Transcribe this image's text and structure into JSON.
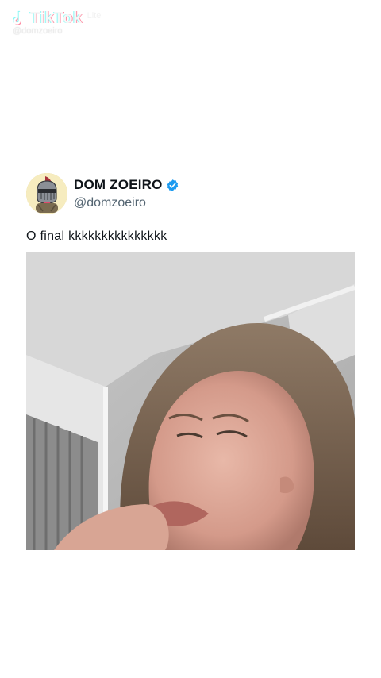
{
  "watermark": {
    "app_name": "TikTok",
    "app_suffix": "Lite",
    "handle": "@domzoeiro"
  },
  "post": {
    "display_name": "DOM ZOEIRO",
    "handle": "@domzoeiro",
    "verified": true,
    "text": "O final kkkkkkkkkkkkkkk"
  },
  "icons": {
    "logo": "tiktok-note-icon",
    "verified": "verified-badge-icon"
  },
  "colors": {
    "text_primary": "#0f1419",
    "text_secondary": "#536471",
    "verified_blue": "#1d9bf0",
    "tiktok_cyan": "#25f4ee",
    "tiktok_red": "#fe2c55"
  }
}
